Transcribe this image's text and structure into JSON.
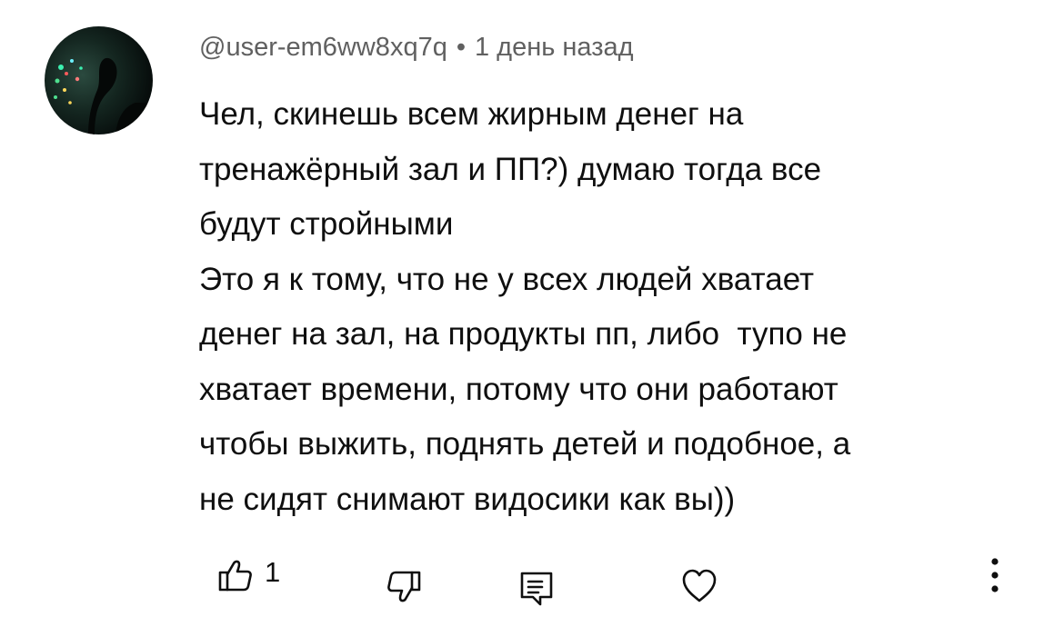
{
  "comment": {
    "author": "@user-em6ww8xq7q",
    "separator": "•",
    "time": "1 день назад",
    "lines": [
      "Чел, скинешь всем жирным денег на",
      "тренажёрный зал и ПП?) думаю тогда все",
      "будут стройными",
      "Это я к тому, что не у всех людей хватает",
      "денег на зал, на продукты пп, либо  тупо не",
      "хватает времени, потому что они работают",
      "чтобы выжить, поднять детей и подобное, а",
      "не сидят снимают видосики как вы))"
    ]
  },
  "actions": {
    "like_count": "1",
    "icons": [
      "thumb-up-icon",
      "thumb-down-icon",
      "reply-icon",
      "heart-icon",
      "more-vert-icon"
    ]
  },
  "colors": {
    "text": "#0f0f0f",
    "secondary_text": "#606060",
    "background": "#ffffff"
  }
}
